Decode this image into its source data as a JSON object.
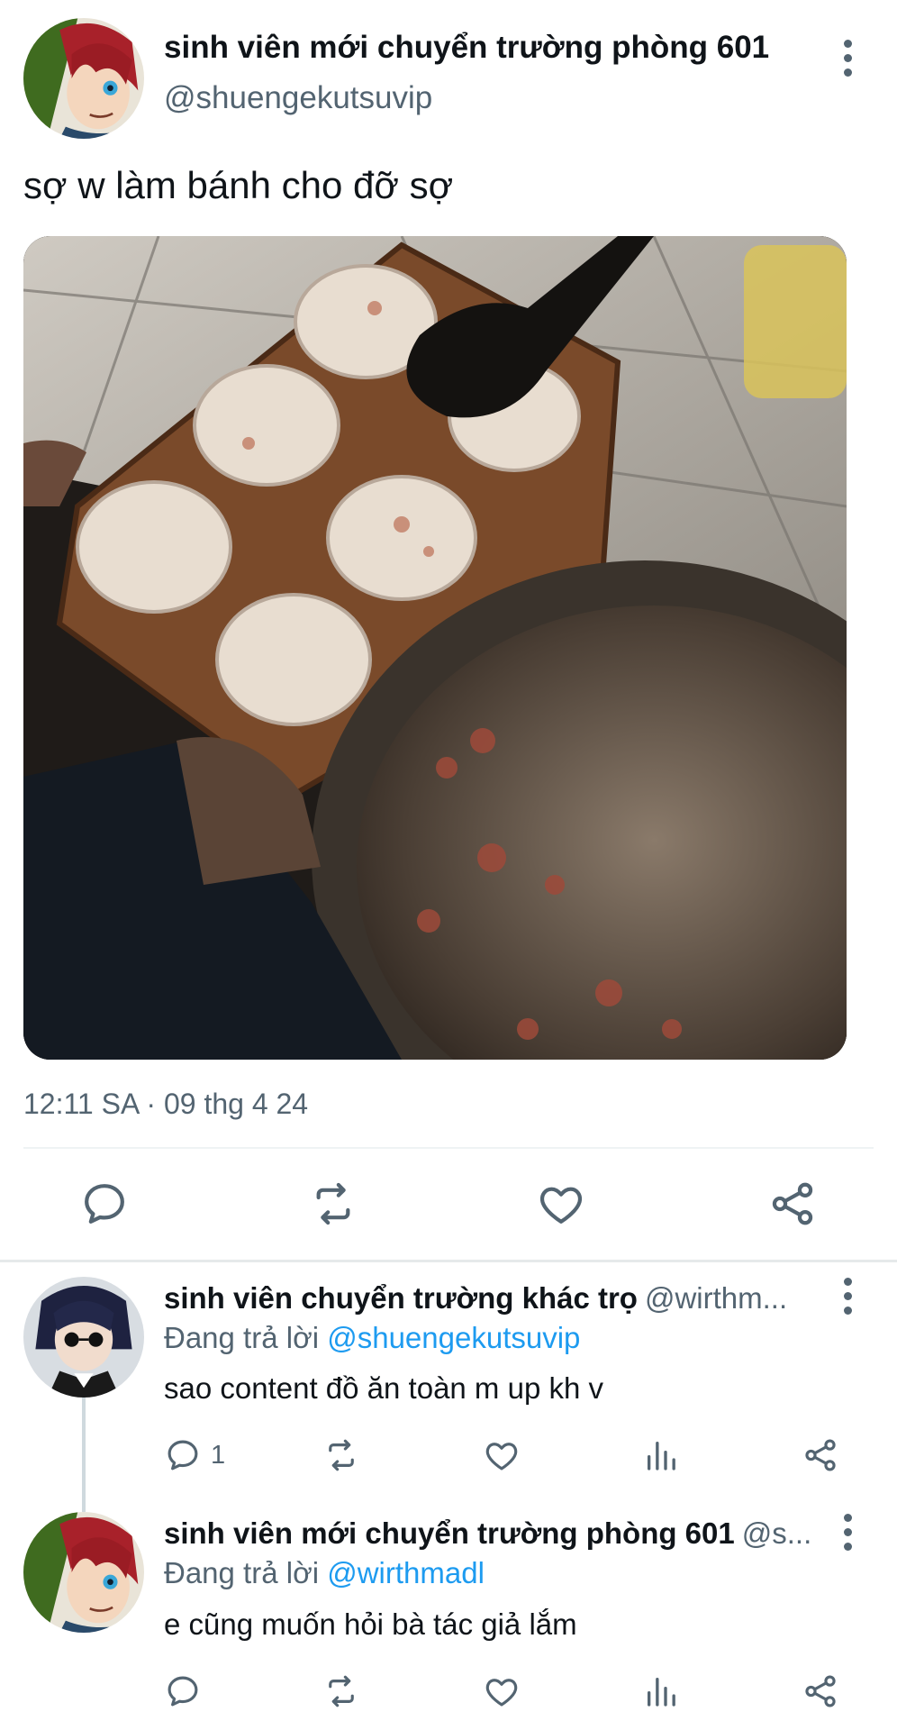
{
  "main_tweet": {
    "display_name": "sinh viên mới chuyển trường phòng 601",
    "handle": "@shuengekutsuvip",
    "text": "sợ w làm bánh cho đỡ sợ",
    "timestamp": "12:11 SA · 09 thg 4 24",
    "avatar_icon": "anime-avatar-red-hair",
    "media_icon": "photo-baking-muffins"
  },
  "actions": {
    "icons": [
      "reply-icon",
      "retweet-icon",
      "like-icon",
      "share-icon"
    ]
  },
  "replies": [
    {
      "display_name": "sinh viên chuyển trường khác trọ",
      "handle": "@wirthm...",
      "replying_prefix": "Đang trả lời ",
      "replying_to": "@shuengekutsuvip",
      "text": "sao content đồ ăn toàn m up kh v",
      "reply_count": "1",
      "avatar_icon": "anime-avatar-dark-hair-glasses"
    },
    {
      "display_name": "sinh viên mới chuyển trường phòng 601",
      "handle": "@s...",
      "replying_prefix": "Đang trả lời ",
      "replying_to": "@wirthmadl",
      "text": "e cũng muốn hỏi bà tác giả lắm",
      "reply_count": "",
      "avatar_icon": "anime-avatar-red-hair"
    }
  ],
  "colors": {
    "text": "#0f1419",
    "secondary": "#536471",
    "link": "#1d9bf0",
    "divider": "#eff3f4"
  }
}
